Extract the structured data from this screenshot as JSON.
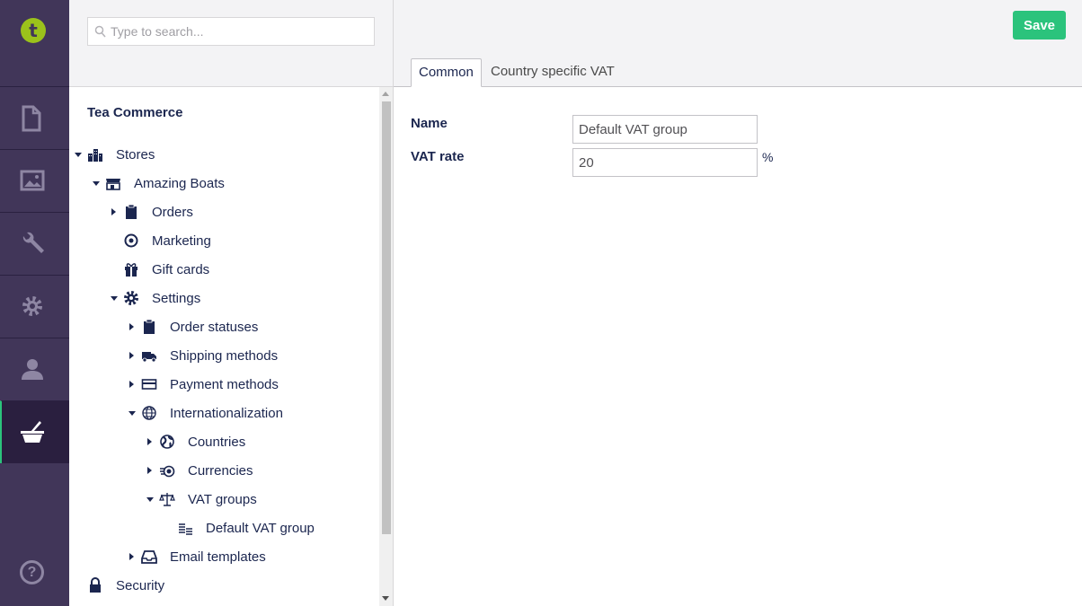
{
  "rail": {
    "logo_letter": "t",
    "sections": [
      "content-icon",
      "media-icon",
      "developer-icon",
      "settings-icon",
      "members-icon",
      "commerce-icon"
    ],
    "help": "?"
  },
  "tree": {
    "search_placeholder": "Type to search...",
    "root": "Tea Commerce",
    "nodes": [
      {
        "label": "Stores",
        "icon": "stores-icon"
      },
      {
        "label": "Amazing Boats",
        "icon": "store-icon"
      },
      {
        "label": "Orders",
        "icon": "clipboard-icon"
      },
      {
        "label": "Marketing",
        "icon": "target-icon"
      },
      {
        "label": "Gift cards",
        "icon": "gift-icon"
      },
      {
        "label": "Settings",
        "icon": "gear-icon"
      },
      {
        "label": "Order statuses",
        "icon": "clipboard-icon"
      },
      {
        "label": "Shipping methods",
        "icon": "truck-icon"
      },
      {
        "label": "Payment methods",
        "icon": "credit-card-icon"
      },
      {
        "label": "Internationalization",
        "icon": "globe-icon"
      },
      {
        "label": "Countries",
        "icon": "earth-icon"
      },
      {
        "label": "Currencies",
        "icon": "coins-icon"
      },
      {
        "label": "VAT groups",
        "icon": "scales-icon"
      },
      {
        "label": "Default VAT group",
        "icon": "coin-stack-icon"
      },
      {
        "label": "Email templates",
        "icon": "inbox-icon"
      },
      {
        "label": "Security",
        "icon": "lock-icon"
      }
    ]
  },
  "editor": {
    "save_label": "Save",
    "tabs": [
      "Common",
      "Country specific VAT"
    ],
    "fields": {
      "name_label": "Name",
      "name_value": "Default VAT group",
      "vat_label": "VAT rate",
      "vat_value": "20",
      "vat_unit": "%"
    }
  },
  "colors": {
    "rail_bg": "#413659",
    "accent_green": "#2bc37c",
    "logo_green": "#9bc21b"
  }
}
